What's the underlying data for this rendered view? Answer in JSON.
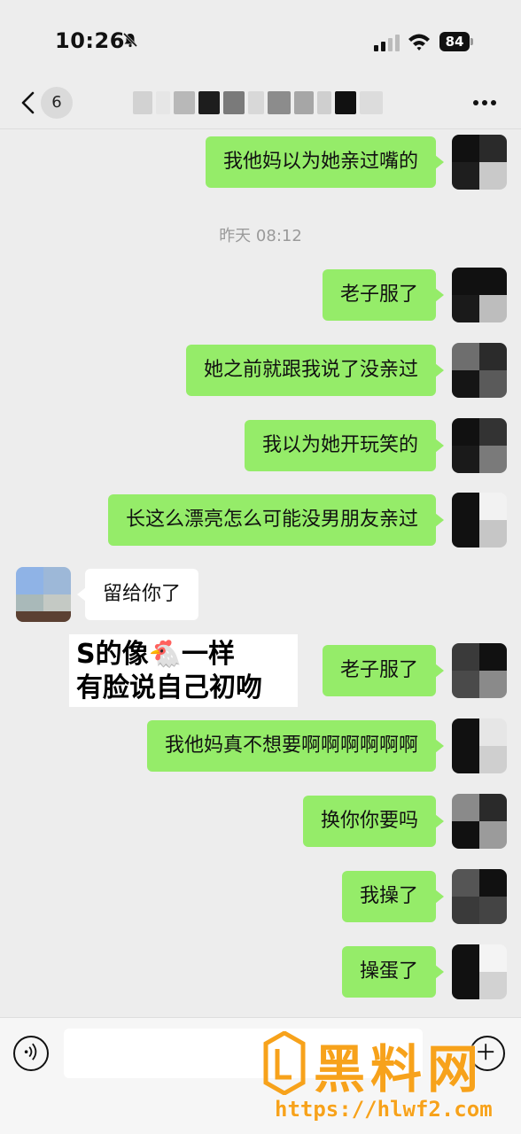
{
  "status_bar": {
    "time": "10:26",
    "battery": "84"
  },
  "nav": {
    "unread_count": "6"
  },
  "timestamp": "昨天 08:12",
  "messages": [
    {
      "side": "me",
      "text": "我他妈以为她亲过嘴的"
    },
    {
      "side": "me",
      "text": "老子服了"
    },
    {
      "side": "me",
      "text": "她之前就跟我说了没亲过"
    },
    {
      "side": "me",
      "text": "我以为她开玩笑的"
    },
    {
      "side": "me",
      "text": "长这么漂亮怎么可能没男朋友亲过"
    },
    {
      "side": "them",
      "text": "留给你了"
    },
    {
      "side": "me",
      "text": "老子服了"
    },
    {
      "side": "me",
      "text": "我他妈真不想要啊啊啊啊啊啊"
    },
    {
      "side": "me",
      "text": "换你你要吗"
    },
    {
      "side": "me",
      "text": "我操了"
    },
    {
      "side": "me",
      "text": "操蛋了"
    }
  ],
  "overlay_caption": {
    "line1": "S的像🐔一样",
    "line2": "有脸说自己初吻"
  },
  "watermark": {
    "brand": "黑料网",
    "url": "https://hlwf2.com"
  },
  "colors": {
    "my_bubble": "#95ec69",
    "their_bubble": "#ffffff",
    "background": "#ededed",
    "watermark": "#f7a21b"
  },
  "icons": [
    "chevron-left-icon",
    "bell-slash-icon",
    "signal-icon",
    "wifi-icon",
    "battery-icon",
    "more-icon",
    "voice-icon",
    "plus-icon"
  ]
}
